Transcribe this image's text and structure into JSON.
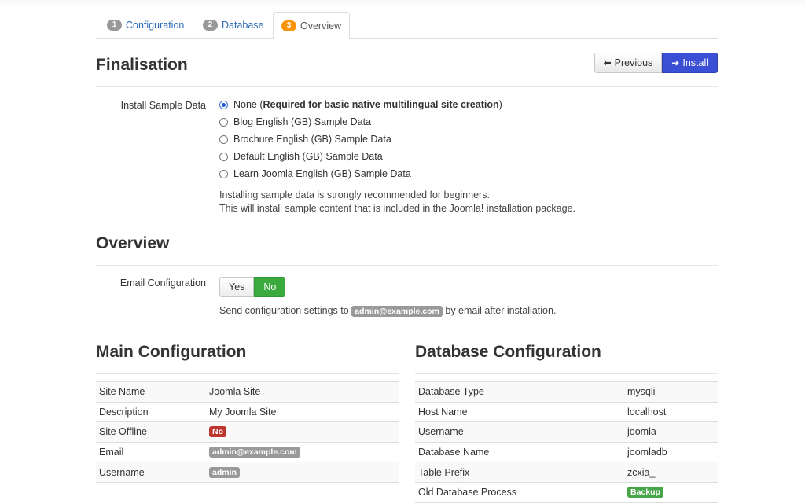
{
  "tabs": [
    {
      "num": "1",
      "label": "Configuration"
    },
    {
      "num": "2",
      "label": "Database"
    },
    {
      "num": "3",
      "label": "Overview"
    }
  ],
  "finalisation": {
    "title": "Finalisation",
    "previous_label": "Previous",
    "install_label": "Install",
    "sample_data_label": "Install Sample Data",
    "options": [
      {
        "prefix": "None (",
        "bold": "Required for basic native multilingual site creation",
        "suffix": ")",
        "checked": true
      },
      {
        "prefix": "Blog English (GB) Sample Data",
        "bold": "",
        "suffix": "",
        "checked": false
      },
      {
        "prefix": "Brochure English (GB) Sample Data",
        "bold": "",
        "suffix": "",
        "checked": false
      },
      {
        "prefix": "Default English (GB) Sample Data",
        "bold": "",
        "suffix": "",
        "checked": false
      },
      {
        "prefix": "Learn Joomla English (GB) Sample Data",
        "bold": "",
        "suffix": "",
        "checked": false
      }
    ],
    "help_line1": "Installing sample data is strongly recommended for beginners.",
    "help_line2": "This will install sample content that is included in the Joomla! installation package."
  },
  "overview": {
    "title": "Overview",
    "email_config_label": "Email Configuration",
    "yes_label": "Yes",
    "no_label": "No",
    "selected": "No",
    "send_prefix": "Send configuration settings to",
    "send_email": "admin@example.com",
    "send_suffix": "by email after installation."
  },
  "main_config": {
    "title": "Main Configuration",
    "rows": [
      {
        "key": "Site Name",
        "value": "Joomla Site",
        "type": "text"
      },
      {
        "key": "Description",
        "value": "My Joomla Site",
        "type": "text"
      },
      {
        "key": "Site Offline",
        "value": "No",
        "type": "badge-red"
      },
      {
        "key": "Email",
        "value": "admin@example.com",
        "type": "badge-gray"
      },
      {
        "key": "Username",
        "value": "admin",
        "type": "badge-gray"
      }
    ]
  },
  "db_config": {
    "title": "Database Configuration",
    "rows": [
      {
        "key": "Database Type",
        "value": "mysqli",
        "type": "text"
      },
      {
        "key": "Host Name",
        "value": "localhost",
        "type": "text"
      },
      {
        "key": "Username",
        "value": "joomla",
        "type": "text"
      },
      {
        "key": "Database Name",
        "value": "joomladb",
        "type": "text"
      },
      {
        "key": "Table Prefix",
        "value": "zcxia_",
        "type": "text"
      },
      {
        "key": "Old Database Process",
        "value": "Backup",
        "type": "badge-green"
      }
    ]
  },
  "colors": {
    "install_button": "#3a4fd3",
    "no_toggle": "#3aaa3f",
    "active_tab_badge": "#f89406",
    "badge_red": "#bd362f",
    "badge_green": "#46a546",
    "link": "#2a69b8"
  }
}
